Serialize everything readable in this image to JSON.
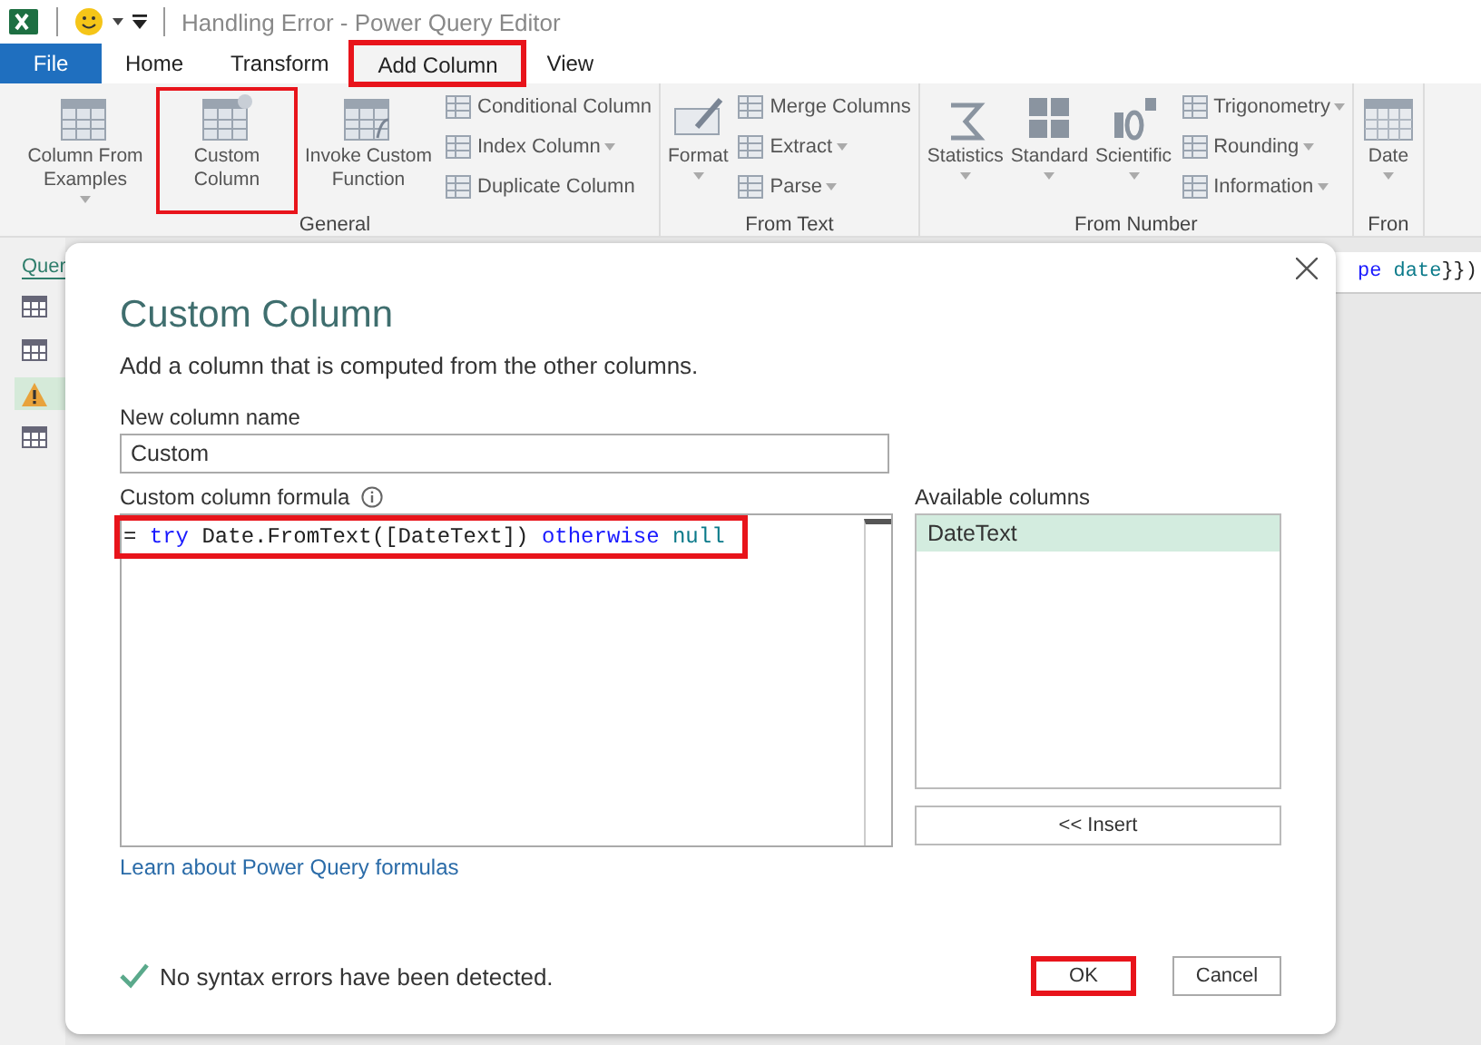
{
  "title_bar": {
    "title": "Handling Error - Power Query Editor"
  },
  "tabs": [
    {
      "label": "File",
      "kind": "file",
      "selected": false,
      "highlighted": false
    },
    {
      "label": "Home",
      "kind": "tab",
      "selected": false,
      "highlighted": false
    },
    {
      "label": "Transform",
      "kind": "tab",
      "selected": false,
      "highlighted": false
    },
    {
      "label": "Add Column",
      "kind": "tab",
      "selected": true,
      "highlighted": true
    },
    {
      "label": "View",
      "kind": "tab",
      "selected": false,
      "highlighted": false
    }
  ],
  "ribbon": {
    "groups": [
      {
        "label": "General",
        "large": [
          {
            "label": "Column From Examples",
            "dropdown": true,
            "highlighted": false
          },
          {
            "label": "Custom Column",
            "dropdown": false,
            "highlighted": true
          },
          {
            "label": "Invoke Custom Function",
            "dropdown": false,
            "highlighted": false
          }
        ],
        "small": [
          {
            "label": "Conditional Column",
            "dropdown": false
          },
          {
            "label": "Index Column",
            "dropdown": true
          },
          {
            "label": "Duplicate Column",
            "dropdown": false
          }
        ]
      },
      {
        "label": "From Text",
        "large": [
          {
            "label": "Format",
            "dropdown": true,
            "highlighted": false
          }
        ],
        "small": [
          {
            "label": "Merge Columns",
            "dropdown": false
          },
          {
            "label": "Extract",
            "dropdown": true
          },
          {
            "label": "Parse",
            "dropdown": true
          }
        ]
      },
      {
        "label": "From Number",
        "large": [
          {
            "label": "Statistics",
            "dropdown": true,
            "highlighted": false
          },
          {
            "label": "Standard",
            "dropdown": true,
            "highlighted": false
          },
          {
            "label": "Scientific",
            "dropdown": true,
            "highlighted": false
          }
        ],
        "small": [
          {
            "label": "Trigonometry",
            "dropdown": true
          },
          {
            "label": "Rounding",
            "dropdown": true
          },
          {
            "label": "Information",
            "dropdown": true
          }
        ]
      },
      {
        "label": "Fron",
        "large": [
          {
            "label": "Date",
            "dropdown": true,
            "highlighted": false
          }
        ]
      }
    ]
  },
  "queries_pane": {
    "title": "Quer",
    "items": [
      {
        "kind": "table",
        "selected": false
      },
      {
        "kind": "table",
        "selected": false
      },
      {
        "kind": "warning",
        "selected": true
      },
      {
        "kind": "table",
        "selected": false
      }
    ]
  },
  "formula_bar": {
    "tokens": [
      {
        "text": "pe",
        "kind": "keyword"
      },
      {
        "text": " date",
        "kind": "literal"
      },
      {
        "text": "}})",
        "kind": "plain"
      }
    ]
  },
  "dialog": {
    "title": "Custom Column",
    "description": "Add a column that is computed from the other columns.",
    "name_label": "New column name",
    "name_value": "Custom",
    "formula_label": "Custom column formula",
    "formula": {
      "highlighted": true,
      "tokens": [
        {
          "text": "= ",
          "kind": "plain"
        },
        {
          "text": "try",
          "kind": "keyword"
        },
        {
          "text": " Date.FromText([DateText]) ",
          "kind": "plain"
        },
        {
          "text": "otherwise",
          "kind": "keyword"
        },
        {
          "text": " null",
          "kind": "literal"
        }
      ]
    },
    "available_label": "Available columns",
    "available_columns": [
      {
        "label": "DateText",
        "selected": true
      }
    ],
    "insert_button": "<< Insert",
    "link": "Learn about Power Query formulas",
    "status": "No syntax errors have been detected.",
    "ok": {
      "label": "OK",
      "highlighted": true
    },
    "cancel": "Cancel"
  }
}
